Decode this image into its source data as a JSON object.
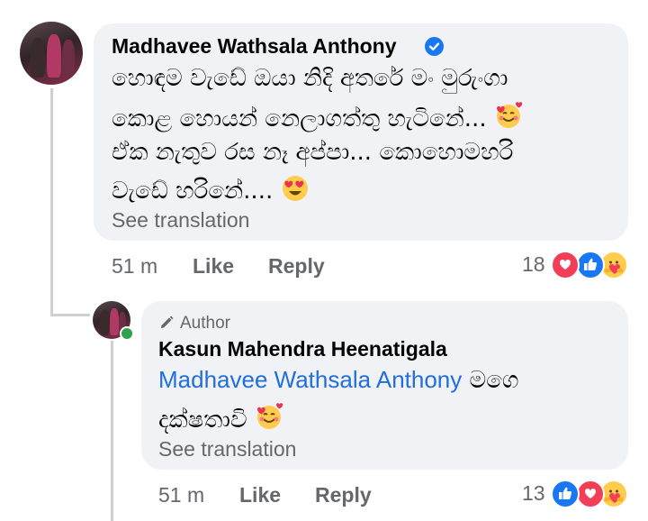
{
  "comment": {
    "author": "Madhavee Wathsala Anthony",
    "lines": [
      "හොඳම වැඩේ ඔයා නිදි අතරේ මං මුරුංගා",
      "කොළ හොයන් නෙලාගත්තු හැටිනේ...",
      "ඒක නැතුව රස නෑ අප්පා... කොහොමහරි",
      "වැඩේ හරිනේ...."
    ],
    "see_translation": "See translation",
    "time": "51 m",
    "like_label": "Like",
    "reply_label": "Reply",
    "reaction_count": "18",
    "reactions": [
      "love-icon",
      "like-icon",
      "care-icon"
    ]
  },
  "reply": {
    "author_badge": "Author",
    "author": "Kasun Mahendra Heenatigala",
    "mention": "Madhavee Wathsala Anthony",
    "line1_rest": " මගෙ",
    "line2": "දක්ෂතාවි",
    "see_translation": "See translation",
    "time": "51 m",
    "like_label": "Like",
    "reply_label": "Reply",
    "reaction_count": "13",
    "reactions": [
      "like-icon",
      "love-icon",
      "care-icon"
    ]
  },
  "colors": {
    "bubble": "#f0f2f5",
    "secondary_text": "#65676b",
    "link": "#216fdb",
    "verified": "#1877f2",
    "love": "#f33e58",
    "like": "#1877f2",
    "online": "#31a24c"
  }
}
